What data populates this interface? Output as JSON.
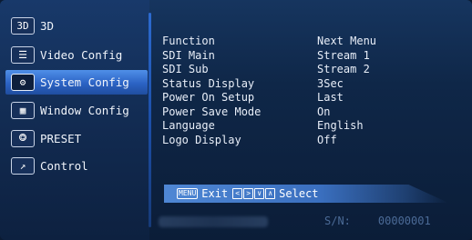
{
  "sidebar": {
    "items": [
      {
        "icon": "3D",
        "icon_name": "3d-badge-icon",
        "label": "3D"
      },
      {
        "icon": "☰",
        "icon_name": "video-config-icon",
        "label": "Video Config"
      },
      {
        "icon": "⚙",
        "icon_name": "gear-icon",
        "label": "System Config",
        "active": true
      },
      {
        "icon": "▦",
        "icon_name": "window-config-icon",
        "label": "Window Config"
      },
      {
        "icon": "⭗",
        "icon_name": "preset-icon",
        "label": "PRESET"
      },
      {
        "icon": "↗",
        "icon_name": "control-icon",
        "label": "Control"
      }
    ]
  },
  "settings": {
    "header": {
      "key": "Function",
      "value": "Next Menu"
    },
    "rows": [
      {
        "key": "SDI Main",
        "value": "Stream 1"
      },
      {
        "key": "SDI Sub",
        "value": "Stream 2"
      },
      {
        "key": "Status Display",
        "value": "3Sec"
      },
      {
        "key": "Power On Setup",
        "value": "Last"
      },
      {
        "key": "Power Save Mode",
        "value": "On"
      },
      {
        "key": "Language",
        "value": "English"
      },
      {
        "key": "Logo Display",
        "value": "Off"
      }
    ]
  },
  "footer": {
    "menu_key": "MENU",
    "exit_label": "Exit",
    "arrow_keys": [
      "<",
      ">",
      "∨",
      "∧"
    ],
    "select_label": "Select"
  },
  "serial": {
    "label": "S/N:",
    "value": "00000001"
  },
  "colors": {
    "accent": "#2c63c4",
    "background": "#0f2748",
    "divider": "#2d6bd0"
  }
}
